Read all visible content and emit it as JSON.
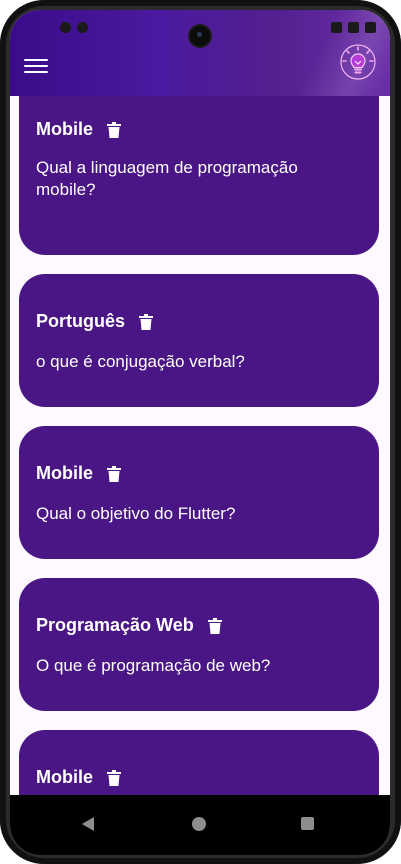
{
  "appbar": {
    "menu_icon": "menu-icon",
    "logo_icon": "lightbulb-icon",
    "gradient_colors": [
      "#3a0c8a",
      "#6a2fa8"
    ]
  },
  "cards": [
    {
      "title": "Mobile",
      "question": "Qual a linguagem de programação mobile?"
    },
    {
      "title": "Português",
      "question": "o que é conjugação verbal?"
    },
    {
      "title": "Mobile",
      "question": "Qual o objetivo do Flutter?"
    },
    {
      "title": "Programação Web",
      "question": "O que é programação de web?"
    },
    {
      "title": "Mobile",
      "question": ""
    }
  ],
  "colors": {
    "card_bg": "#4a1585",
    "screen_bg": "#fff8ff",
    "text": "#ffffff"
  },
  "navbar": {
    "back_icon": "back-triangle-icon",
    "home_icon": "home-circle-icon",
    "recents_icon": "recents-square-icon"
  }
}
